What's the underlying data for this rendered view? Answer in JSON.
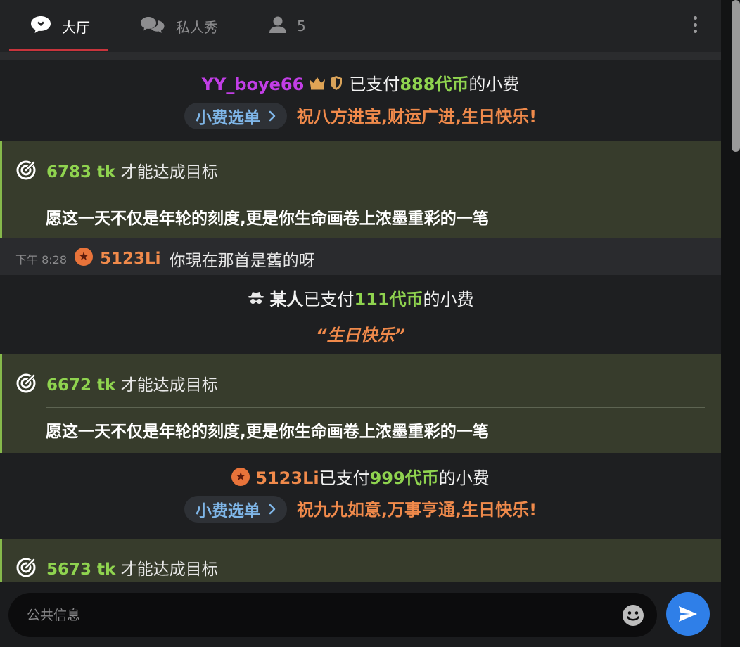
{
  "tabs": {
    "lobby": "大厅",
    "private_show": "私人秀",
    "user_count": "5"
  },
  "feed": {
    "tip1": {
      "username": "YY_boye66",
      "paid_prefix": "已支付",
      "amount": "888代币",
      "suffix": "的小费",
      "menu_label": "小费选单",
      "message": "祝八方进宝,财运广进,生日快乐!"
    },
    "goal1": {
      "amount": "6783 tk",
      "label": "才能达成目标",
      "message": "愿这一天不仅是年轮的刻度,更是你生命画卷上浓墨重彩的一笔"
    },
    "chat1": {
      "time": "下午 8:28",
      "username": "5123Li",
      "text": "你現在那首是舊的呀"
    },
    "tip2": {
      "username": "某人",
      "paid_prefix": "已支付",
      "amount": "111代币",
      "suffix": "的小费",
      "quote": "“生日快乐”"
    },
    "goal2": {
      "amount": "6672 tk",
      "label": "才能达成目标",
      "message": "愿这一天不仅是年轮的刻度,更是你生命画卷上浓墨重彩的一笔"
    },
    "tip3": {
      "username": "5123Li",
      "paid_prefix": "已支付",
      "amount": "999代币",
      "suffix": "的小费",
      "menu_label": "小费选单",
      "message": "祝九九如意,万事亨通,生日快乐!"
    },
    "goal3": {
      "amount": "5673 tk",
      "label": "才能达成目标"
    }
  },
  "input": {
    "placeholder": "公共信息",
    "value": ""
  },
  "colors": {
    "accent_red": "#c8343c",
    "coin_green": "#8fd34f",
    "username_purple": "#c23ee6",
    "username_orange": "#f08a4b",
    "send_blue": "#2f7fe8"
  },
  "icons": [
    "chat-bubble-icon",
    "two-bubbles-icon",
    "user-icon",
    "more-vertical-icon",
    "crown-icon",
    "shield-icon",
    "star-badge-icon",
    "chevron-right-icon",
    "target-icon",
    "spy-icon",
    "emoji-icon",
    "send-icon"
  ]
}
